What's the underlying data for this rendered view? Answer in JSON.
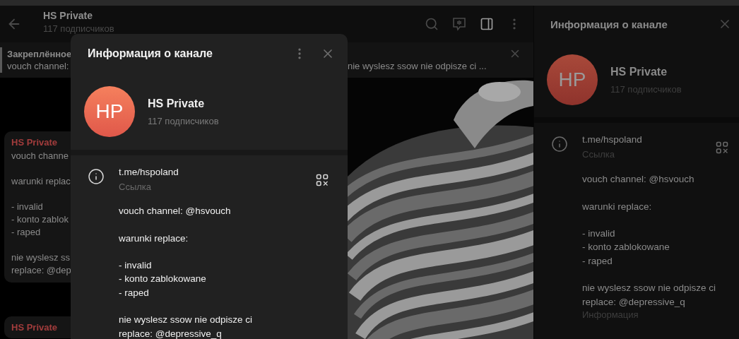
{
  "chat_header": {
    "title": "HS Private",
    "subtitle": "117 подписчиков"
  },
  "pinned": {
    "label": "Закреплённое",
    "preview_start": "vouch channel:",
    "preview_end": "nie wyslesz ssow nie odpisze ci ..."
  },
  "messages": [
    {
      "sender": "HS Private",
      "text": "vouch channe\n\nwarunki replac\n\n- invalid\n- konto zablok\n- raped\n\nnie wyslesz ss\nreplace: @dep"
    },
    {
      "sender": "HS Private"
    }
  ],
  "info_panel": {
    "title": "Информация о канале",
    "avatar_initials": "HP",
    "name": "HS Private",
    "subscribers": "117 подписчиков",
    "link": "t.me/hspoland",
    "link_label": "Ссылка",
    "description": "vouch channel: @hsvouch\n\nwarunki replace:\n\n- invalid\n- konto zablokowane\n- raped\n\nnie wyslesz ssow nie odpisze ci\nreplace: @depressive_q",
    "description_label": "Информация"
  },
  "dialog": {
    "title": "Информация о канале",
    "avatar_initials": "HP",
    "name": "HS Private",
    "subscribers": "117 подписчиков",
    "link": "t.me/hspoland",
    "link_label": "Ссылка",
    "description": "vouch channel: @hsvouch\n\nwarunki replace:\n\n- invalid\n- konto zablokowane\n- raped\n\nnie wyslesz ssow nie odpisze ci\nreplace: @depressive_q"
  }
}
